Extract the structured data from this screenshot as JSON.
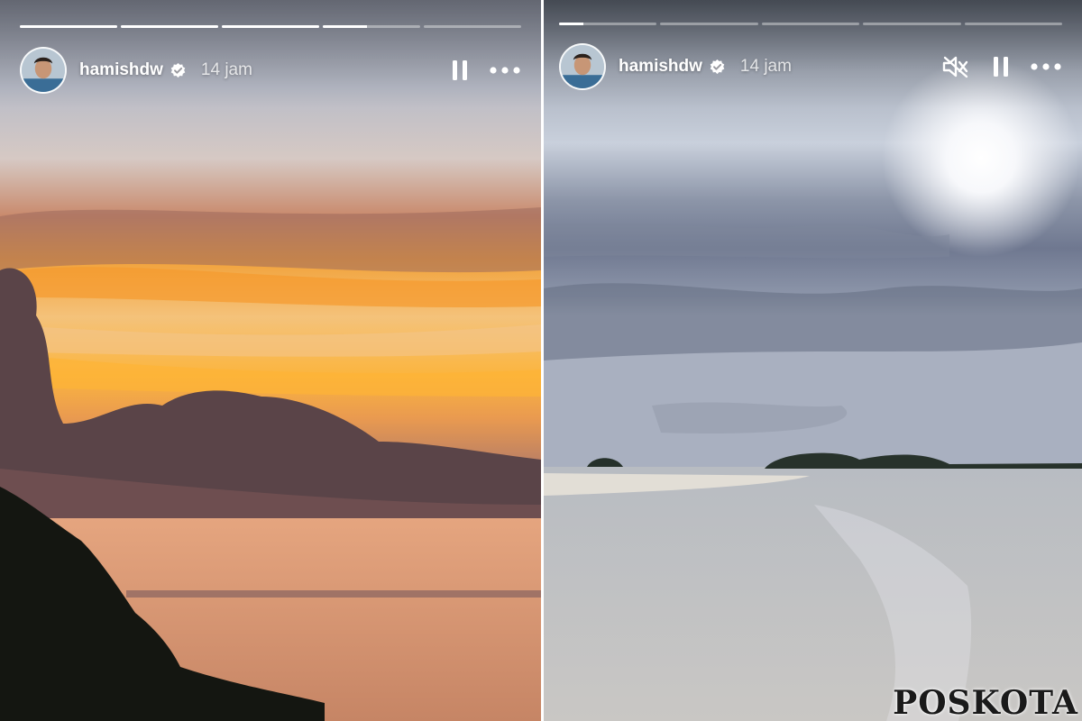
{
  "left_story": {
    "username": "hamishdw",
    "time_ago": "14 jam",
    "progress": [
      1,
      1,
      1,
      0.45,
      0
    ],
    "controls": {
      "pause_icon": "pause-icon",
      "more_icon": "more-horizontal-icon"
    }
  },
  "right_story": {
    "username": "hamishdw",
    "time_ago": "14 jam",
    "progress": [
      0.25,
      0,
      0,
      0,
      0
    ],
    "controls": {
      "mute_icon": "speaker-muted-icon",
      "pause_icon": "pause-icon",
      "more_icon": "more-horizontal-icon"
    }
  },
  "watermark": {
    "text": "POSKOTA"
  },
  "colors": {
    "verified_badge": "#ffffff",
    "progress_track": "rgba(255,255,255,0.38)",
    "progress_fill": "#ffffff"
  }
}
